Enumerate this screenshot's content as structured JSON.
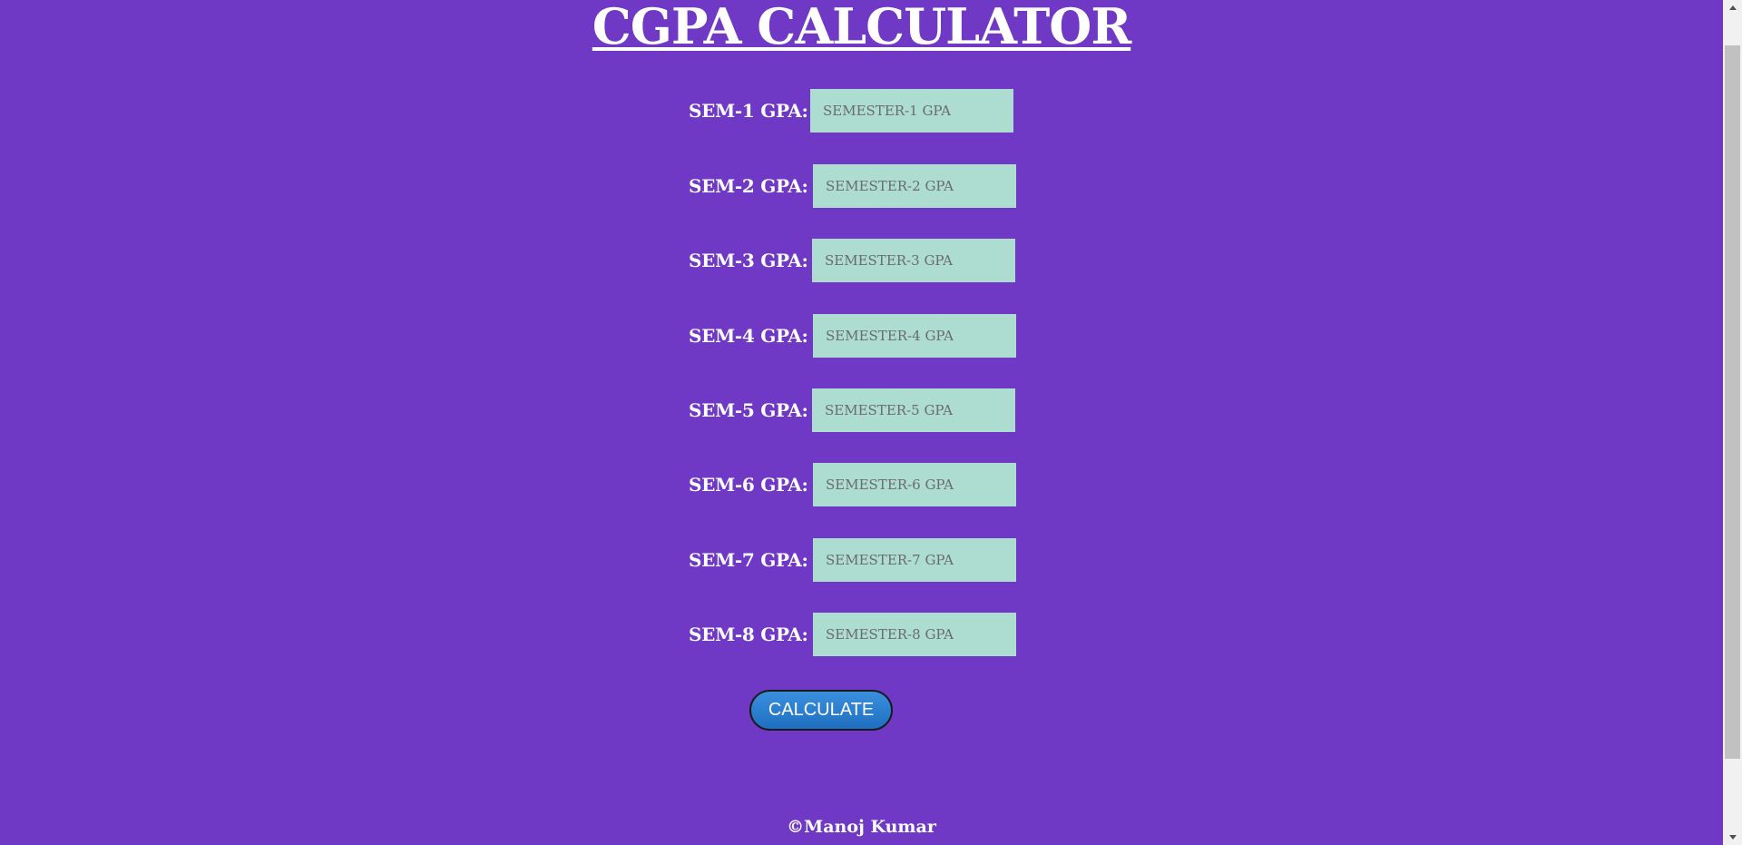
{
  "header": {
    "title": "CGPA CALCULATOR"
  },
  "form": {
    "rows": [
      {
        "label": "SEM-1 GPA:",
        "placeholder": "SEMESTER-1 GPA",
        "value": ""
      },
      {
        "label": "SEM-2 GPA:",
        "placeholder": "SEMESTER-2 GPA",
        "value": ""
      },
      {
        "label": "SEM-3 GPA:",
        "placeholder": "SEMESTER-3 GPA",
        "value": ""
      },
      {
        "label": "SEM-4 GPA:",
        "placeholder": "SEMESTER-4 GPA",
        "value": ""
      },
      {
        "label": "SEM-5 GPA:",
        "placeholder": "SEMESTER-5 GPA",
        "value": ""
      },
      {
        "label": "SEM-6 GPA:",
        "placeholder": "SEMESTER-6 GPA",
        "value": ""
      },
      {
        "label": "SEM-7 GPA:",
        "placeholder": "SEMESTER-7 GPA",
        "value": ""
      },
      {
        "label": "SEM-8 GPA:",
        "placeholder": "SEMESTER-8 GPA",
        "value": ""
      }
    ],
    "calculate_label": "CALCULATE"
  },
  "footer": {
    "text": "©Manoj Kumar"
  },
  "colors": {
    "background": "#6f38c5",
    "input_background": "#addcd0",
    "button_background": "#2a7fd0",
    "text": "#ffffff"
  }
}
